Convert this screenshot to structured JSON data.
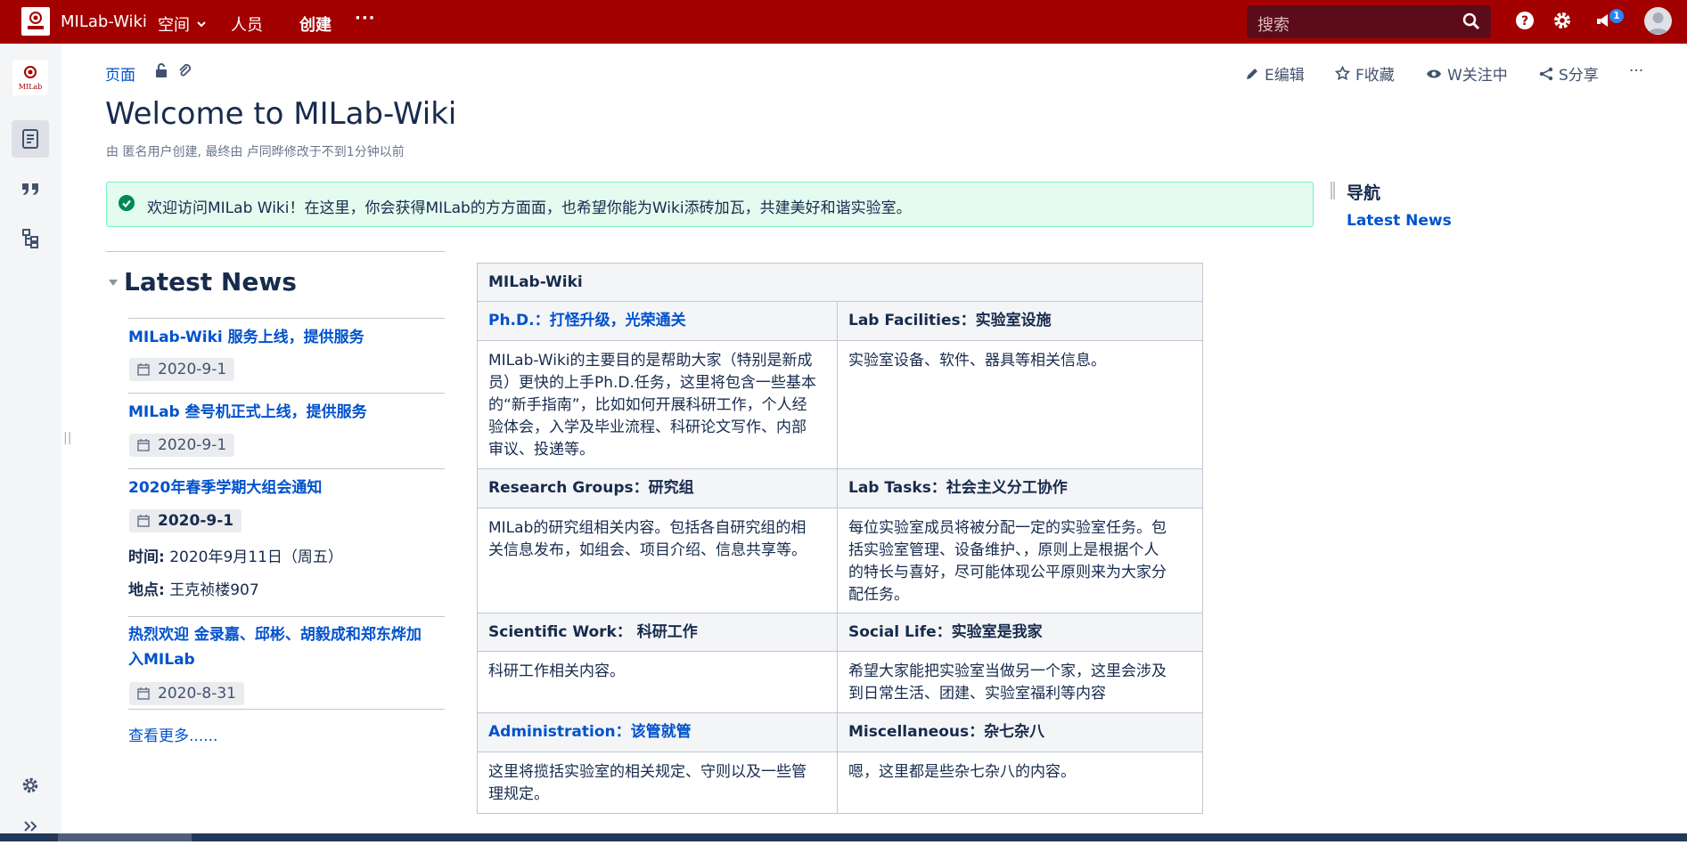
{
  "header": {
    "brand": "MILab-Wiki",
    "nav_spaces": "空间",
    "nav_people": "人员",
    "create": "创建",
    "more": "···",
    "search_placeholder": "搜索",
    "notification_count": "1"
  },
  "logo": {
    "text": "MILab"
  },
  "breadcrumb": {
    "pages": "页面"
  },
  "page_actions": {
    "edit": "E编辑",
    "save": "F收藏",
    "watch": "W关注中",
    "share": "S分享",
    "more": "···"
  },
  "page": {
    "title": "Welcome to MILab-Wiki",
    "byline": "由 匿名用户创建, 最终由 卢同晔修改于不到1分钟以前"
  },
  "info_panel": "欢迎访问MILab Wiki！在这里，你会获得MILab的方方面面，也希望你能为Wiki添砖加瓦，共建美好和谐实验室。",
  "navigation": {
    "title": "导航",
    "link": "Latest News"
  },
  "news": {
    "heading": "Latest News",
    "items": [
      {
        "title": "MILab-Wiki 服务上线，提供服务",
        "date": "2020-9-1"
      },
      {
        "title": "MILab 叁号机正式上线，提供服务",
        "date": "2020-9-1"
      },
      {
        "title": "2020年春季学期大组会通知",
        "date": "2020-9-1",
        "time_label": "时间:",
        "time_value": " 2020年9月11日（周五）",
        "place_label": "地点:",
        "place_value": " 王克祯楼907"
      },
      {
        "title_line1": "热烈欢迎 金录嘉、邱彬、胡毅成和郑东烨加",
        "title_line2": "入MILab",
        "date": "2020-8-31"
      }
    ],
    "see_more": "查看更多......"
  },
  "table": {
    "header": "MILab-Wiki",
    "rows": [
      {
        "h1": "Ph.D.：打怪升级，光荣通关",
        "h2": "Lab Facilities：实验室设施",
        "c1": [
          "MILab-Wiki的主要目的是帮助大家（特别是新成",
          "员）更快的上手Ph.D.任务，这里将包含一些基本",
          "的“新手指南”，比如如何开展科研工作，个人经",
          "验体会，入学及毕业流程、科研论文写作、内部",
          "审议、投递等。"
        ],
        "c2": [
          "实验室设备、软件、器具等相关信息。"
        ]
      },
      {
        "h1": "Research Groups：研究组",
        "h2": "Lab Tasks：社会主义分工协作",
        "c1": [
          "MILab的研究组相关内容。包括各自研究组的相",
          "关信息发布，如组会、项目介绍、信息共享等。"
        ],
        "c2": [
          "每位实验室成员将被分配一定的实验室任务。包",
          "括实验室管理、设备维护、，原则上是根据个人",
          "的特长与喜好，尽可能体现公平原则来为大家分",
          "配任务。"
        ]
      },
      {
        "h1": "Scientific Work： 科研工作",
        "h2": "Social Life：实验室是我家",
        "c1": [
          "科研工作相关内容。"
        ],
        "c2": [
          "希望大家能把实验室当做另一个家，这里会涉及",
          "到日常生活、团建、实验室福利等内容"
        ]
      },
      {
        "h1": "Administration：该管就管",
        "h2": "Miscellaneous：杂七杂八",
        "c1": [
          "这里将揽括实验室的相关规定、守则以及一些管",
          "理规定。"
        ],
        "c2": [
          "嗯，这里都是些杂七杂八的内容。"
        ]
      }
    ]
  },
  "colors": {
    "header_bg": "#a30000",
    "link": "#0052cc",
    "info_bg": "#e3fcef"
  }
}
